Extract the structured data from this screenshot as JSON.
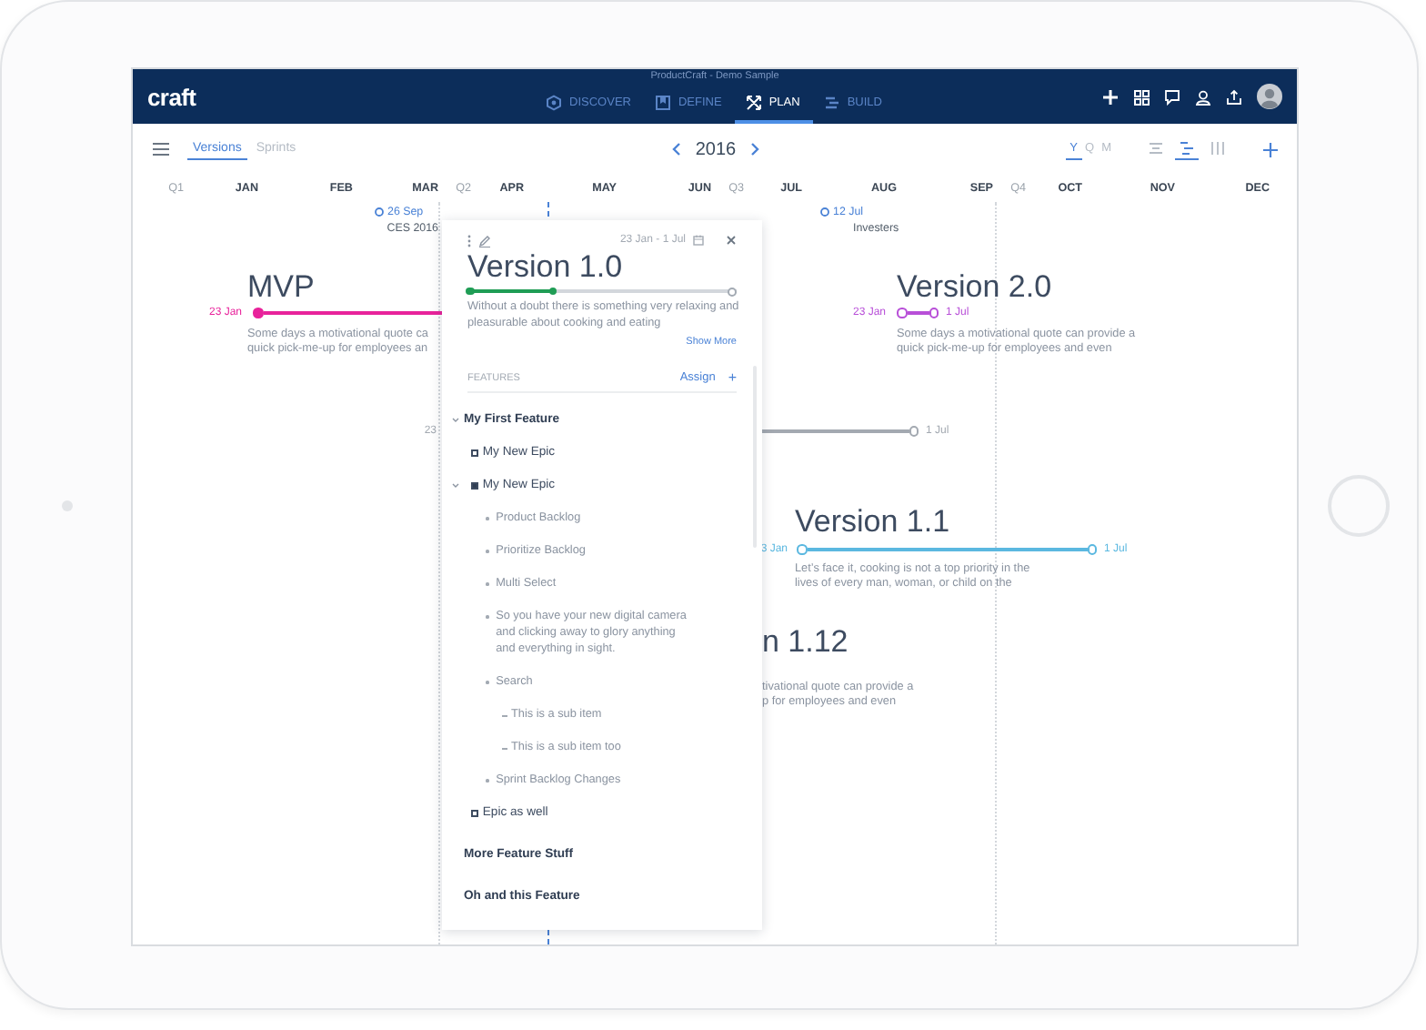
{
  "window": {
    "title": "ProductCraft - Demo Sample"
  },
  "header": {
    "logo": "craft",
    "nav": [
      {
        "label": "DISCOVER",
        "selected": false
      },
      {
        "label": "DEFINE",
        "selected": false
      },
      {
        "label": "PLAN",
        "selected": true
      },
      {
        "label": "BUILD",
        "selected": false
      }
    ]
  },
  "toolbar": {
    "views": [
      {
        "label": "Versions",
        "selected": true
      },
      {
        "label": "Sprints",
        "selected": false
      }
    ],
    "year": "2016",
    "scales": [
      {
        "label": "Y",
        "selected": true
      },
      {
        "label": "Q",
        "selected": false
      },
      {
        "label": "M",
        "selected": false
      }
    ],
    "layouts": [
      {
        "selected": false
      },
      {
        "selected": true
      },
      {
        "selected": false
      }
    ]
  },
  "ruler": [
    {
      "label": "Q1",
      "kind": "quarter"
    },
    {
      "label": "JAN",
      "kind": "month"
    },
    {
      "label": "FEB",
      "kind": "month"
    },
    {
      "label": "MAR",
      "kind": "month"
    },
    {
      "label": "Q2",
      "kind": "quarter"
    },
    {
      "label": "APR",
      "kind": "month"
    },
    {
      "label": "MAY",
      "kind": "month"
    },
    {
      "label": "JUN",
      "kind": "month"
    },
    {
      "label": "Q3",
      "kind": "quarter"
    },
    {
      "label": "JUL",
      "kind": "month"
    },
    {
      "label": "AUG",
      "kind": "month"
    },
    {
      "label": "SEP",
      "kind": "month"
    },
    {
      "label": "Q4",
      "kind": "quarter"
    },
    {
      "label": "OCT",
      "kind": "month"
    },
    {
      "label": "NOV",
      "kind": "month"
    },
    {
      "label": "DEC",
      "kind": "month"
    }
  ],
  "milestones": [
    {
      "date": "26 Sep",
      "label": "CES 2016"
    },
    {
      "date": "12 Jul",
      "label": "Investers"
    }
  ],
  "versions": [
    {
      "title": "MVP",
      "start": "23 Jan",
      "color": "#e8239b",
      "filled": true,
      "description": [
        "Some days a motivational quote ca",
        "quick pick-me-up for employees an"
      ]
    },
    {
      "title": "Version 2.0",
      "start": "23 Jan",
      "end": "1 Jul",
      "color": "#b84fd8",
      "filled": false,
      "description": [
        "Some days a motivational quote can provide a",
        "quick pick-me-up for employees and even"
      ]
    },
    {
      "start": "23",
      "end": "1 Jul",
      "color": "#a3a9b1"
    },
    {
      "title": "Version 1.1",
      "start": "3 Jan",
      "end": "1 Jul",
      "color": "#5bb8e0",
      "filled": false,
      "description": [
        "Let’s face it, cooking is not a top priority in the",
        "lives of every man, woman, or child on the"
      ]
    },
    {
      "title": "n 1.12",
      "description": [
        "tivational quote can provide a",
        "p for employees and even"
      ]
    }
  ],
  "popup": {
    "dates": "23 Jan - 1 Jul",
    "title": "Version 1.0",
    "progress": {
      "level": 0.32
    },
    "description": "Without a doubt there is something very relaxing and pleasurable about cooking and eating",
    "show_more": "Show More",
    "features_label": "FEATURES",
    "assign": "Assign",
    "add": "+",
    "features": [
      {
        "name": "My First Feature",
        "kind": "feature",
        "expanded": true,
        "children": [
          {
            "name": "My New Epic",
            "kind": "epic",
            "expanded": false
          },
          {
            "name": "My New Epic",
            "kind": "epic",
            "expanded": true,
            "children": [
              {
                "name": "Product Backlog",
                "kind": "story"
              },
              {
                "name": "Prioritize Backlog",
                "kind": "story"
              },
              {
                "name": "Multi Select",
                "kind": "story"
              },
              {
                "name": "So you have your new digital camera and clicking away to glory anything and everything in sight.",
                "kind": "story"
              },
              {
                "name": "Search",
                "kind": "story",
                "children": [
                  {
                    "name": "This is a sub item",
                    "kind": "subitem"
                  },
                  {
                    "name": "This is a sub item too",
                    "kind": "subitem"
                  }
                ]
              },
              {
                "name": "Sprint Backlog Changes",
                "kind": "story"
              }
            ]
          },
          {
            "name": "Epic as well",
            "kind": "epic",
            "expanded": false
          }
        ]
      },
      {
        "name": "More Feature Stuff",
        "kind": "feature",
        "expanded": false
      },
      {
        "name": "Oh and this Feature",
        "kind": "feature",
        "expanded": false
      }
    ]
  }
}
